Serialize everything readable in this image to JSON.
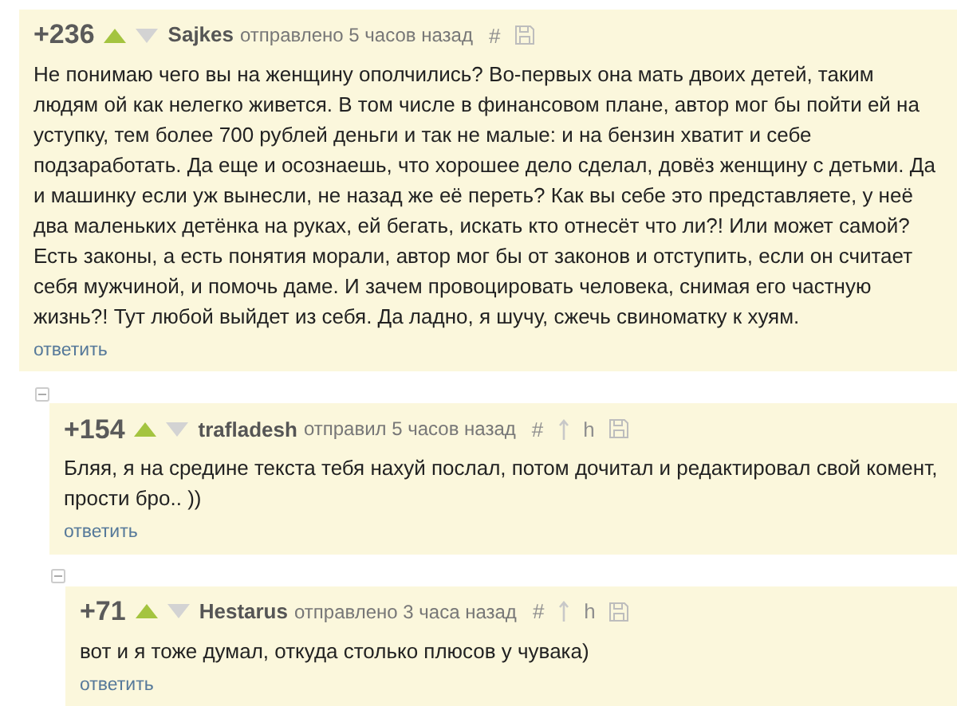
{
  "comments": [
    {
      "score": "+236",
      "author": "Sajkes",
      "meta": "отправлено 5 часов назад",
      "tools": [
        {
          "kind": "glyph",
          "text": "#"
        },
        {
          "kind": "save"
        }
      ],
      "text": "Не понимаю чего вы на женщину ополчились? Во-первых она мать двоих детей, таким людям ой как нелегко живется. В том числе в финансовом плане, автор мог бы пойти ей на уступку, тем более 700 рублей деньги и так не малые: и на бензин хватит и себе подзаработать. Да еще и осознаешь, что хорошее дело сделал, довёз женщину с детьми. Да и машинку если уж вынесли, не назад же её переть? Как вы себе это представляете, у неё два маленьких детёнка на руках, ей бегать, искать кто отнесёт что ли?! Или может самой? Есть законы, а есть понятия морали, автор мог бы от законов и отступить, если он считает себя мужчиной, и помочь даме. И зачем провоцировать человека, снимая его частную жизнь?! Тут любой выйдет из себя. Да ладно, я шучу, сжечь свиноматку к хуям.",
      "reply": "ответить",
      "children": [
        {
          "score": "+154",
          "author": "trafladesh",
          "meta": "отправил 5 часов назад",
          "tools": [
            {
              "kind": "glyph",
              "text": "#"
            },
            {
              "kind": "arrow"
            },
            {
              "kind": "glyph",
              "text": "h"
            },
            {
              "kind": "save"
            }
          ],
          "text": "Бляя, я на средине текста тебя нахуй послал, потом дочитал и редактировал свой комент, прости бро.. ))",
          "reply": "ответить",
          "children": [
            {
              "score": "+71",
              "author": "Hestarus",
              "meta": "отправлено 3 часа назад",
              "tools": [
                {
                  "kind": "glyph",
                  "text": "#"
                },
                {
                  "kind": "arrow"
                },
                {
                  "kind": "glyph",
                  "text": "h"
                },
                {
                  "kind": "save"
                }
              ],
              "text": "вот и я тоже думал, откуда столько плюсов у чувака)",
              "reply": "ответить"
            }
          ]
        }
      ]
    }
  ]
}
